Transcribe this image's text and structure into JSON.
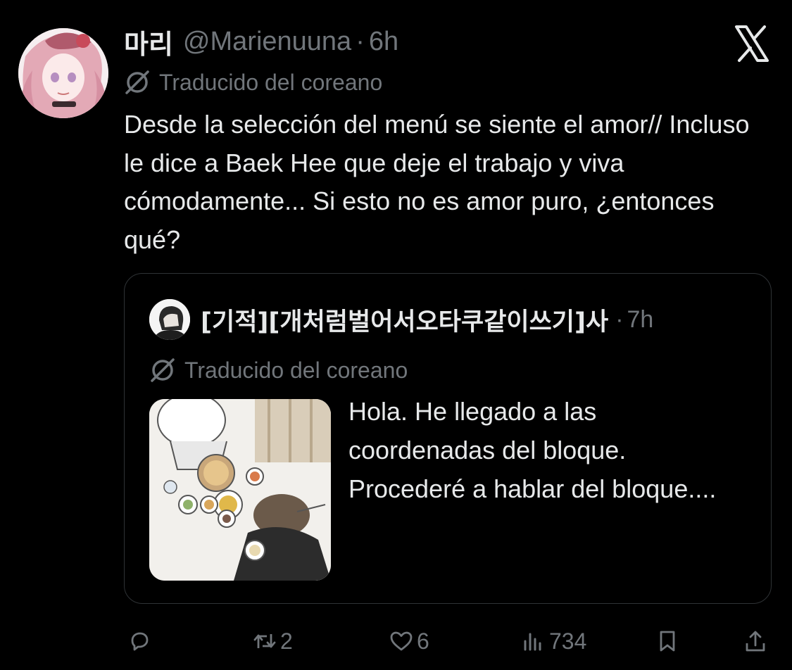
{
  "tweet": {
    "author": {
      "display_name": "마리",
      "handle": "@Marienuuna",
      "separator": "·",
      "time": "6h"
    },
    "translated_label": "Traducido del coreano",
    "text": "Desde la selección del menú se siente el amor// Incluso le dice a Baek Hee que deje el trabajo y viva cómodamente... Si esto no es amor puro, ¿entonces qué?"
  },
  "quote": {
    "author": {
      "display_name": "[기적][개처럼벌어서오타쿠같이쓰기]사",
      "separator": "·",
      "time": "7h"
    },
    "translated_label": "Traducido del coreano",
    "text": "Hola. He llegado a las coordenadas del bloque. Procederé a hablar del bloque...."
  },
  "actions": {
    "reply": {
      "icon": "reply-icon",
      "count": ""
    },
    "retweet": {
      "icon": "retweet-icon",
      "count": "2"
    },
    "like": {
      "icon": "heart-icon",
      "count": "6"
    },
    "views": {
      "icon": "views-chart-icon",
      "count": "734"
    },
    "bookmark": {
      "icon": "bookmark-icon"
    },
    "share": {
      "icon": "share-icon"
    }
  },
  "colors": {
    "background": "#000000",
    "primary_text": "#e7e9ea",
    "secondary_text": "#71767b",
    "border": "#2f3336"
  }
}
